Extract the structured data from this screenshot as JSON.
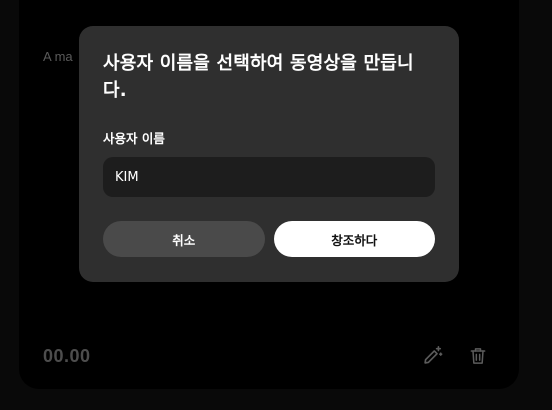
{
  "card": {
    "caption": "A ma",
    "duration": "00.00",
    "edit_icon": "magic-pencil-icon",
    "delete_icon": "trash-icon"
  },
  "modal": {
    "title": "사용자 이름을 선택하여 동영상을 만듭니다.",
    "field_label": "사용자 이름",
    "field_value": "KIM",
    "cancel_label": "취소",
    "create_label": "창조하다"
  },
  "colors": {
    "page_background": "#090909",
    "card_background": "#000000",
    "modal_background": "#2f2f2f",
    "input_background": "#1d1d1d",
    "cancel_button": "#4a4a4a",
    "create_button": "#ffffff",
    "muted_icon": "#5c5c5c"
  }
}
